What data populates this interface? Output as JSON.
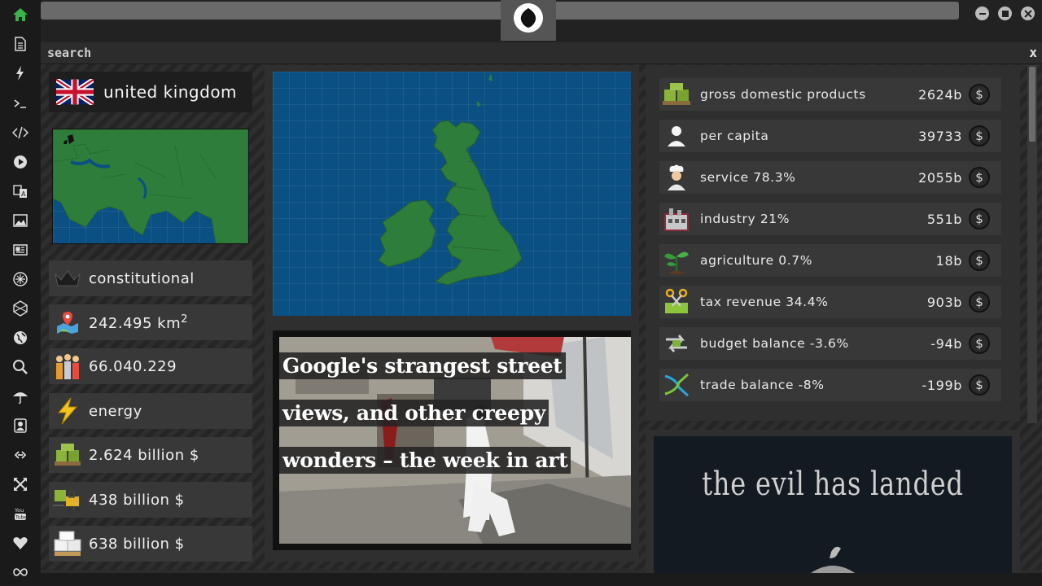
{
  "sidebar": {
    "items": [
      {
        "name": "home-icon"
      },
      {
        "name": "document-icon"
      },
      {
        "name": "lightning-icon"
      },
      {
        "name": "terminal-icon"
      },
      {
        "name": "code-icon"
      },
      {
        "name": "play-icon"
      },
      {
        "name": "translate-icon"
      },
      {
        "name": "image-icon"
      },
      {
        "name": "newspaper-icon"
      },
      {
        "name": "star-burst-icon"
      },
      {
        "name": "hexagon-icon"
      },
      {
        "name": "globe-icon"
      },
      {
        "name": "search-icon"
      },
      {
        "name": "umbrella-icon"
      },
      {
        "name": "contact-icon"
      },
      {
        "name": "link-icon"
      },
      {
        "name": "expand-icon"
      },
      {
        "name": "youtube-icon"
      },
      {
        "name": "heart-icon"
      },
      {
        "name": "infinity-icon"
      }
    ]
  },
  "search": {
    "label": "search",
    "close": "x"
  },
  "country": {
    "name": "united kingdom",
    "government": "constitutional",
    "area": "242.495 km",
    "area_sup": "2",
    "population": "66.040.229",
    "sector": "energy",
    "gdp": "2.624 billion $",
    "figure2": "438 billion $",
    "figure3": "638 billion $"
  },
  "news": {
    "line1": " Google's strangest street",
    "line2": "views, and other creepy",
    "line3": "wonders – the week in art"
  },
  "stats": [
    {
      "label": "gross domestic products",
      "value": "2624b",
      "icon": "money-pallet-icon"
    },
    {
      "label": "per capita",
      "value": "39733",
      "icon": "person-icon"
    },
    {
      "label": "service 78.3%",
      "value": "2055b",
      "icon": "chef-icon"
    },
    {
      "label": "industry 21%",
      "value": "551b",
      "icon": "factory-icon"
    },
    {
      "label": "agriculture 0.7%",
      "value": "18b",
      "icon": "sprout-icon"
    },
    {
      "label": "tax revenue 34.4%",
      "value": "903b",
      "icon": "scissors-money-icon"
    },
    {
      "label": "budget balance -3.6%",
      "value": "-94b",
      "icon": "exchange-arrows-icon"
    },
    {
      "label": "trade balance -8%",
      "value": "-199b",
      "icon": "trade-cross-icon"
    }
  ],
  "currency_symbol": "$",
  "ad": {
    "text": "the evil has landed"
  },
  "colors": {
    "map_water": "#0b5083",
    "land": "#2f7d3a",
    "sidebar": "#1a1a1a",
    "home_green": "#3ab44a"
  }
}
